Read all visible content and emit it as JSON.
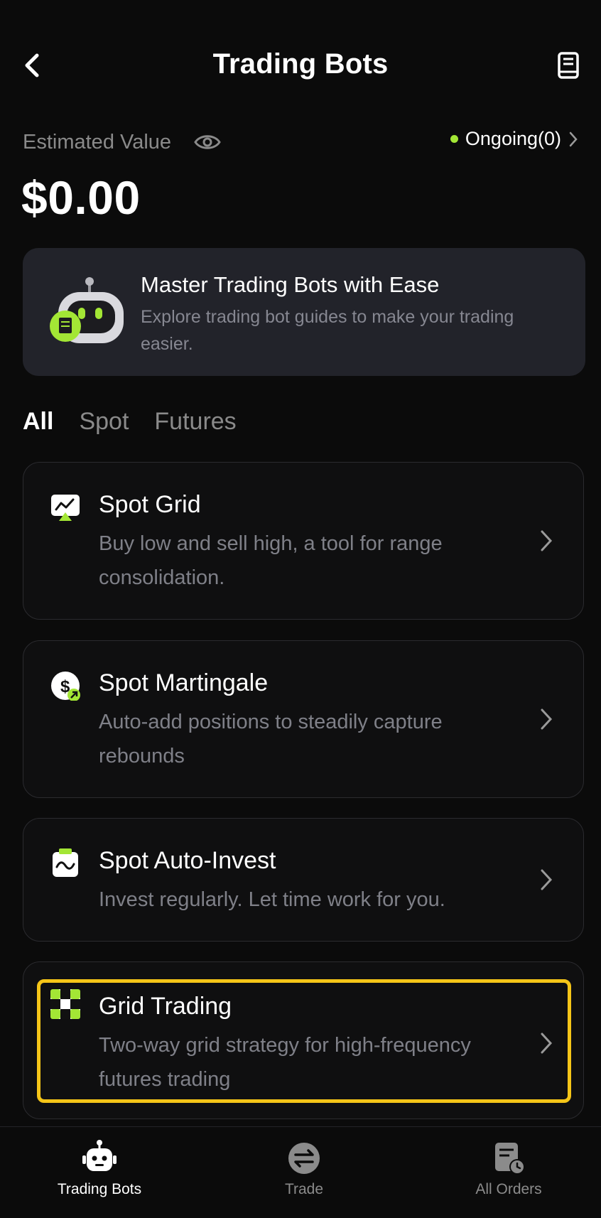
{
  "header": {
    "title": "Trading Bots",
    "back_icon": "chevron-left-icon",
    "guide_icon": "book-icon"
  },
  "summary": {
    "label": "Estimated Value",
    "value": "$0.00",
    "ongoing": "Ongoing(0)",
    "ongoing_dot_color": "#a3e635"
  },
  "banner": {
    "title": "Master Trading Bots with Ease",
    "description": "Explore trading bot guides to make your trading easier."
  },
  "tabs": [
    {
      "label": "All",
      "active": true
    },
    {
      "label": "Spot",
      "active": false
    },
    {
      "label": "Futures",
      "active": false
    }
  ],
  "bots": [
    {
      "icon": "grid-chart-icon",
      "title": "Spot Grid",
      "description": "Buy low and sell high, a tool for range consolidation."
    },
    {
      "icon": "dollar-coin-icon",
      "title": "Spot Martingale",
      "description": "Auto-add positions to steadily capture rebounds"
    },
    {
      "icon": "calendar-wave-icon",
      "title": "Spot Auto-Invest",
      "description": "Invest regularly. Let time work for you."
    },
    {
      "icon": "checker-grid-icon",
      "title": "Grid Trading",
      "description": "Two-way grid strategy for high-frequency futures trading"
    }
  ],
  "bottom_nav": [
    {
      "label": "Trading Bots",
      "icon": "robot-icon",
      "active": true
    },
    {
      "label": "Trade",
      "icon": "exchange-icon",
      "active": false
    },
    {
      "label": "All Orders",
      "icon": "orders-clock-icon",
      "active": false
    }
  ],
  "colors": {
    "accent": "#a3e635",
    "highlight": "#f5c518",
    "background": "#0b0b0b",
    "card_border": "#2b2b2f"
  }
}
